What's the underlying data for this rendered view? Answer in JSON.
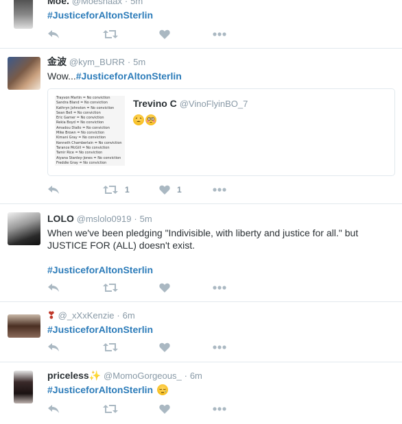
{
  "tweets": [
    {
      "name": "Moe.",
      "handle": "@Moeshaax",
      "time": "5m",
      "text": "",
      "hashtag": "#JusticeforAltonSterlin",
      "retweets": "",
      "likes": ""
    },
    {
      "name": "金波",
      "handle": "@kym_BURR",
      "time": "5m",
      "text": "Wow...",
      "hashtag": "#JusticeforAltonSterlin",
      "retweets": "1",
      "likes": "1",
      "quote": {
        "name": "Trevino C",
        "handle": "@VinoFlyinBO_7",
        "emojis": [
          "weary-face",
          "flushed-face"
        ],
        "image_lines": [
          "Trayvon Martin = No conviction",
          "Sandra Bland = No conviction",
          "Kathryn Johnston = No conviction",
          "Sean Bell = No conviction",
          "Eric Garner = No conviction",
          "Rekia Boyd = No conviction",
          "Amadou Diallo = No conviction",
          "Mike Brown = No conviction",
          "Kimani Gray = No conviction",
          "Kenneth Chamberlain = No conviction",
          "Tarance McGill = No conviction",
          "Tamir Rice = No conviction",
          "Aiyana Stanley-Jones = No conviction",
          "Freddie Gray = No conviction"
        ]
      }
    },
    {
      "name": "LOLO",
      "handle": "@mslolo0919",
      "time": "5m",
      "text": "When we've been pledging \"Indivisible, with liberty and justice for all.\" but JUSTICE FOR (ALL) doesn't exist.",
      "hashtag": "#JusticeforAltonSterlin",
      "retweets": "",
      "likes": ""
    },
    {
      "name": "❣",
      "handle": "@_xXxKenzie",
      "time": "6m",
      "text": "",
      "hashtag": "#JusticeforAltonSterlin",
      "retweets": "",
      "likes": ""
    },
    {
      "name": "priceless✨",
      "handle": "@MomoGorgeous_",
      "time": "6m",
      "text": "",
      "hashtag": "#JusticeforAltonSterlin",
      "emoji": "sleepy-face",
      "retweets": "",
      "likes": ""
    }
  ],
  "colors": {
    "hashtag": "#2b7bb9",
    "meta": "#8899a6",
    "action_icon": "#aab8c2",
    "divider": "#e1e8ed"
  }
}
